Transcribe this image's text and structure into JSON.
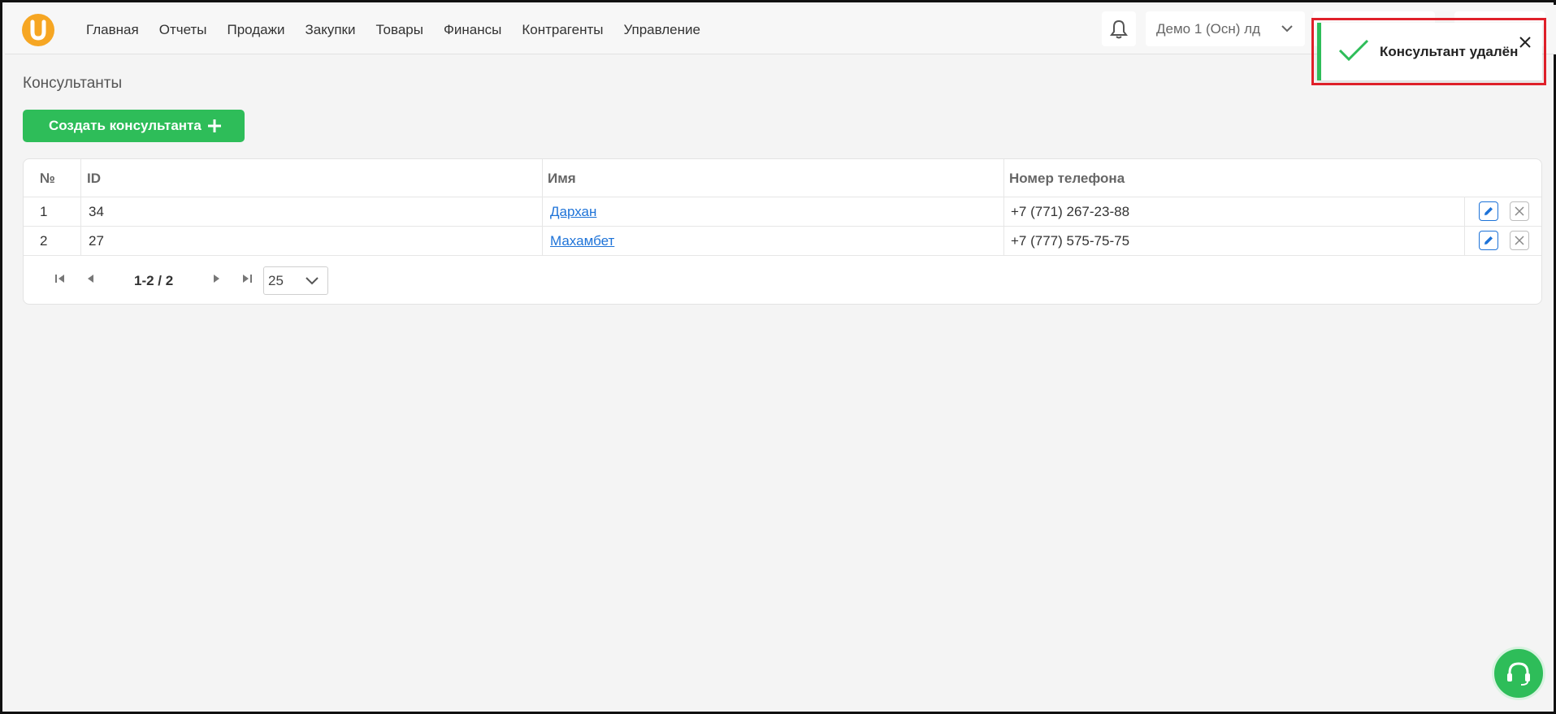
{
  "header": {
    "nav": [
      "Главная",
      "Отчеты",
      "Продажи",
      "Закупки",
      "Товары",
      "Финансы",
      "Контрагенты",
      "Управление"
    ],
    "org_select": "Демо 1 (Осн) лд"
  },
  "page": {
    "title": "Консультанты",
    "create_button": "Создать консультанта"
  },
  "table": {
    "columns": [
      "№",
      "ID",
      "Имя",
      "Номер телефона"
    ],
    "rows": [
      {
        "num": "1",
        "id": "34",
        "name": "Дархан",
        "phone": "+7 (771) 267-23-88"
      },
      {
        "num": "2",
        "id": "27",
        "name": "Махамбет",
        "phone": "+7 (777) 575-75-75"
      }
    ]
  },
  "pagination": {
    "range": "1-2 / 2",
    "per_page": "25"
  },
  "toast": {
    "message": "Консультант удалён"
  },
  "colors": {
    "accent_green": "#2ebd59",
    "link_blue": "#1e73d8",
    "logo_orange": "#f6a623",
    "highlight_red": "#e0202a"
  }
}
